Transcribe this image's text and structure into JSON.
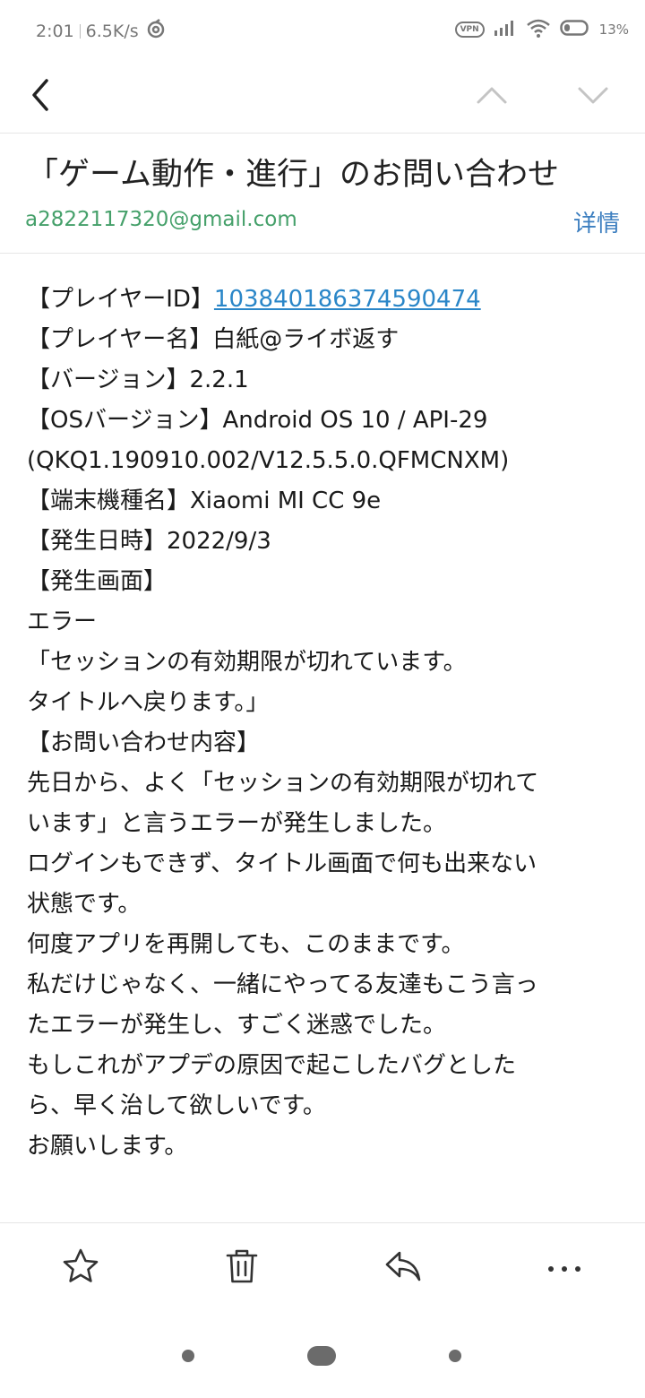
{
  "status_bar": {
    "time": "2:01",
    "speed": "6.5K/s",
    "vpn_label": "VPN",
    "battery": "13%"
  },
  "nav": {
    "back_icon": "chevron-left-icon",
    "prev_icon": "chevron-up-icon",
    "next_icon": "chevron-down-icon"
  },
  "email": {
    "subject": "「ゲーム動作・進行」のお問い合わせ",
    "sender": "a2822117320@gmail.com",
    "details_label": "详情",
    "body": {
      "player_id_label": "【プレイヤーID】",
      "player_id": "103840186374590474",
      "lines": [
        "【プレイヤー名】白紙@ライボ返す",
        "【バージョン】2.2.1",
        "【OSバージョン】Android OS 10 / API-29",
        "(QKQ1.190910.002/V12.5.5.0.QFMCNXM)",
        "【端末機種名】Xiaomi MI CC 9e",
        "【発生日時】2022/9/3",
        "【発生画面】",
        "エラー",
        "「セッションの有効期限が切れています。",
        "タイトルへ戻ります。」",
        "【お問い合わせ内容】",
        "先日から、よく「セッションの有効期限が切れて",
        "います」と言うエラーが発生しました。",
        "ログインもできず、タイトル画面で何も出来ない",
        "状態です。",
        "何度アプリを再開しても、このままです。",
        "私だけじゃなく、一緒にやってる友達もこう言っ",
        "たエラーが発生し、すごく迷惑でした。",
        "もしこれがアプデの原因で起こしたバグとした",
        "ら、早く治して欲しいです。",
        "お願いします。"
      ]
    }
  },
  "toolbar": {
    "star_icon": "star-icon",
    "delete_icon": "trash-icon",
    "reply_icon": "reply-icon",
    "more_icon": "more-icon"
  },
  "colors": {
    "sender": "#45a06a",
    "link": "#2a86c8",
    "details": "#3d7fc0"
  }
}
